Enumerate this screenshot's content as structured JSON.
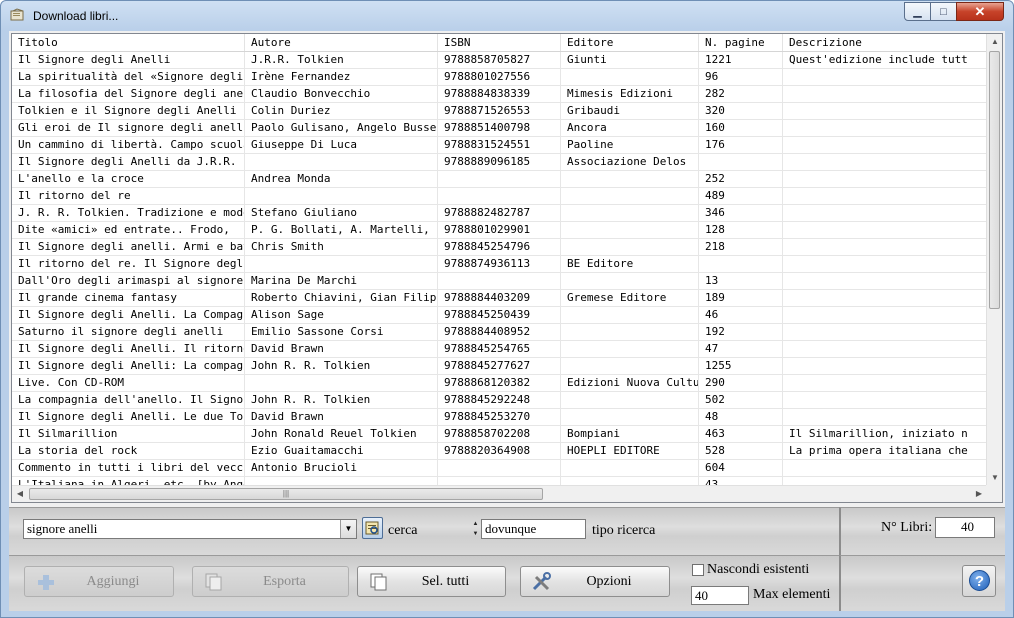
{
  "window": {
    "title": "Download libri...",
    "controls": {
      "minimize": "▁",
      "maximize": "□",
      "close": "✕"
    }
  },
  "table": {
    "columns": [
      "Titolo",
      "Autore",
      "ISBN",
      "Editore",
      "N. pagine",
      "Descrizione"
    ],
    "rows": [
      [
        "Il Signore degli Anelli",
        "J.R.R. Tolkien",
        "9788858705827",
        "Giunti",
        "1221",
        "Quest'edizione include tutt"
      ],
      [
        "La spiritualità del «Signore degli",
        "Irène Fernandez",
        "9788801027556",
        "",
        "96",
        ""
      ],
      [
        "La filosofia del Signore degli anelli",
        "Claudio Bonvecchio",
        "9788884838339",
        "Mimesis Edizioni",
        "282",
        ""
      ],
      [
        "Tolkien e il Signore degli Anelli",
        "Colin Duriez",
        "9788871526553",
        "Gribaudi",
        "320",
        ""
      ],
      [
        "Gli eroi de Il signore degli anelli",
        "Paolo Gulisano, Angelo Busseti",
        "9788851400798",
        "Ancora",
        "160",
        ""
      ],
      [
        "Un cammino di libertà. Campo scuola",
        "Giuseppe Di Luca",
        "9788831524551",
        "Paoline",
        "176",
        ""
      ],
      [
        "Il Signore degli Anelli da J.R.R.",
        "",
        "9788889096185",
        "Associazione Delos",
        "",
        ""
      ],
      [
        "L'anello e la croce",
        "Andrea Monda",
        "",
        "",
        "252",
        ""
      ],
      [
        "Il ritorno del re",
        "",
        "",
        "",
        "489",
        ""
      ],
      [
        "J. R. R. Tolkien. Tradizione e modernità",
        "Stefano Giuliano",
        "9788882482787",
        "",
        "346",
        ""
      ],
      [
        "Dite «amici» ed entrate.. Frodo,",
        "P. G. Bollati, A. Martelli,",
        "9788801029901",
        "",
        "128",
        ""
      ],
      [
        "Il Signore degli anelli. Armi e battaglie",
        "Chris Smith",
        "9788845254796",
        "",
        "218",
        ""
      ],
      [
        "Il ritorno del re. Il Signore degli",
        "",
        "9788874936113",
        "BE Editore",
        "",
        ""
      ],
      [
        "Dall'Oro degli arimaspi al signore",
        "Marina De Marchi",
        "",
        "",
        "13",
        ""
      ],
      [
        "Il grande cinema fantasy",
        "Roberto Chiavini, Gian Filippo",
        "9788884403209",
        "Gremese Editore",
        "189",
        ""
      ],
      [
        "Il Signore degli Anelli. La Compagnia",
        "Alison Sage",
        "9788845250439",
        "",
        "46",
        ""
      ],
      [
        "Saturno il signore degli anelli",
        "Emilio Sassone Corsi",
        "9788884408952",
        "",
        "192",
        ""
      ],
      [
        "Il Signore degli Anelli. Il ritorno",
        "David Brawn",
        "9788845254765",
        "",
        "47",
        ""
      ],
      [
        "Il Signore degli Anelli: La compagnia",
        "John R. R. Tolkien",
        "9788845277627",
        "",
        "1255",
        ""
      ],
      [
        "Live. Con CD-ROM",
        "",
        "9788868120382",
        "Edizioni Nuova Cultura",
        "290",
        ""
      ],
      [
        "La compagnia dell'anello. Il Signore",
        "John R. R. Tolkien",
        "9788845292248",
        "",
        "502",
        ""
      ],
      [
        "Il Signore degli Anelli. Le due Torri",
        "David Brawn",
        "9788845253270",
        "",
        "48",
        ""
      ],
      [
        "Il Silmarillion",
        "John Ronald Reuel Tolkien",
        "9788858702208",
        "Bompiani",
        "463",
        "Il Silmarillion, iniziato n"
      ],
      [
        "La storia del rock",
        "Ezio Guaitamacchi",
        "9788820364908",
        "HOEPLI EDITORE",
        "528",
        "La prima opera italiana che"
      ],
      [
        "Commento in tutti i libri del vecchio",
        "Antonio Brucioli",
        "",
        "",
        "604",
        ""
      ],
      [
        "L'Italiana in Algeri, etc. [by Angelo",
        "",
        "",
        "",
        "43",
        ""
      ]
    ],
    "scroll": {
      "up": "▲",
      "down": "▼",
      "left": "◀",
      "right": "▶",
      "grip": "|||"
    }
  },
  "search": {
    "query": "signore anelli",
    "combo_arrow": "▼",
    "button_label": "cerca",
    "spin_up": "▲",
    "spin_down": "▼",
    "mode_value": "dovunque",
    "mode_label": "tipo ricerca"
  },
  "count": {
    "label": "N° Libri:",
    "value": "40"
  },
  "buttons": {
    "add": "Aggiungi",
    "export": "Esporta",
    "select_all": "Sel. tutti",
    "options": "Opzioni"
  },
  "options": {
    "hide_existing_label": "Nascondi esistenti",
    "hide_existing_checked": false,
    "max_elements_value": "40",
    "max_elements_label": "Max elementi"
  },
  "help": {
    "label": "?"
  }
}
